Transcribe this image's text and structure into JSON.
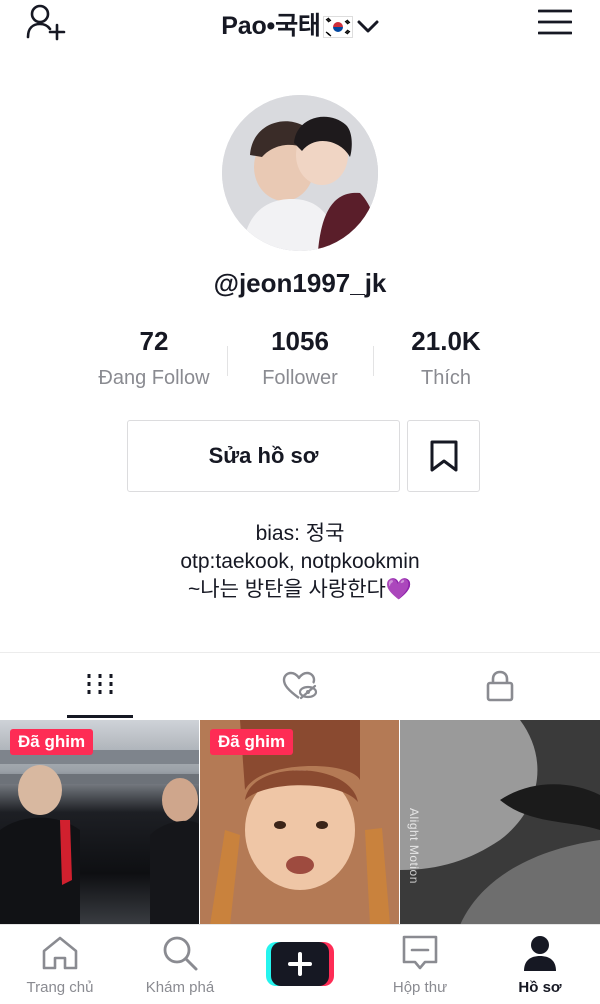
{
  "header": {
    "title": "Pao•국태",
    "flag_icon": "korea-flag-icon",
    "add_user_icon": "add-user-icon",
    "menu_icon": "hamburger-menu-icon"
  },
  "profile": {
    "username": "@jeon1997_jk",
    "stats": [
      {
        "value": "72",
        "label": "Đang Follow"
      },
      {
        "value": "1056",
        "label": "Follower"
      },
      {
        "value": "21.0K",
        "label": "Thích"
      }
    ],
    "edit_label": "Sửa hồ sơ",
    "bio_lines": [
      "bias: 정국",
      "otp:taekook, notpkookmin",
      "~나는 방탄을 사랑한다💜"
    ]
  },
  "tabs": [
    {
      "icon": "video-grid-icon",
      "active": true
    },
    {
      "icon": "liked-hidden-icon",
      "active": false
    },
    {
      "icon": "lock-icon",
      "active": false
    }
  ],
  "videos": [
    {
      "badge": "Đã ghim"
    },
    {
      "badge": "Đã ghim"
    },
    {
      "badge": "",
      "watermark": "Alight Motion"
    }
  ],
  "bottom_nav": [
    {
      "label": "Trang chủ",
      "icon": "home-icon"
    },
    {
      "label": "Khám phá",
      "icon": "search-icon"
    },
    {
      "label": "",
      "icon": "plus-icon"
    },
    {
      "label": "Hộp thư",
      "icon": "inbox-icon"
    },
    {
      "label": "Hồ sơ",
      "icon": "profile-icon",
      "active": true
    }
  ],
  "colors": {
    "accent": "#fe2c55",
    "cyan": "#25f4ee",
    "text": "#161823",
    "muted": "#8a8b91"
  }
}
